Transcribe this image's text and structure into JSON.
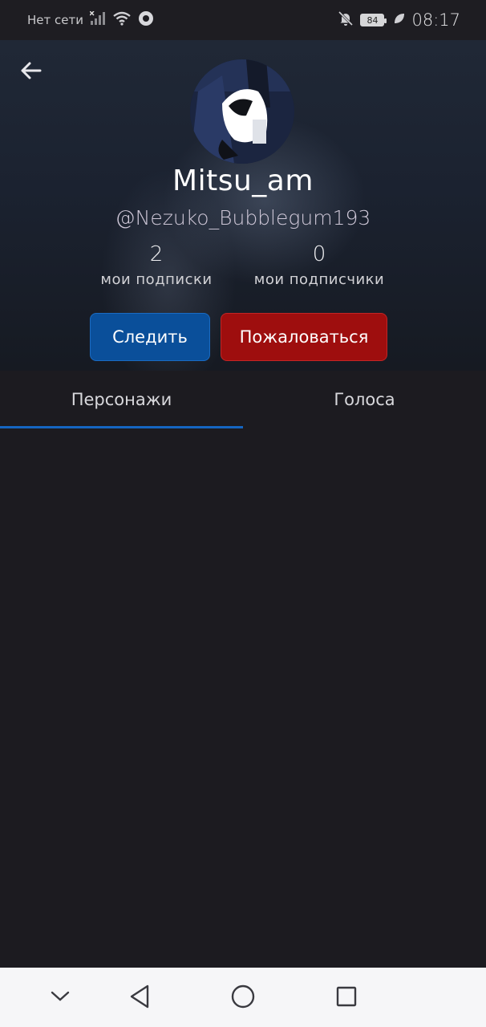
{
  "status_bar": {
    "network_text": "Нет сети",
    "battery_level": "84",
    "time": "08:17"
  },
  "profile": {
    "display_name": "Mitsu_am",
    "handle": "@Nezuko_Bubblegum193",
    "following_count": "2",
    "following_label": "мои подписки",
    "followers_count": "0",
    "followers_label": "мои подписчики"
  },
  "actions": {
    "follow_label": "Следить",
    "report_label": "Пожаловаться"
  },
  "tabs": [
    {
      "label": "Персонажи",
      "active": true
    },
    {
      "label": "Голоса",
      "active": false
    }
  ],
  "colors": {
    "accent_blue": "#0a4f9a",
    "report_red": "#9e0e0e",
    "tab_indicator": "#1565c0",
    "background": "#1c1b20"
  },
  "icons": {
    "back": "arrow-left-icon",
    "nav_down": "chevron-down-icon",
    "nav_back": "triangle-back-icon",
    "nav_home": "circle-home-icon",
    "nav_recent": "square-recent-icon"
  }
}
